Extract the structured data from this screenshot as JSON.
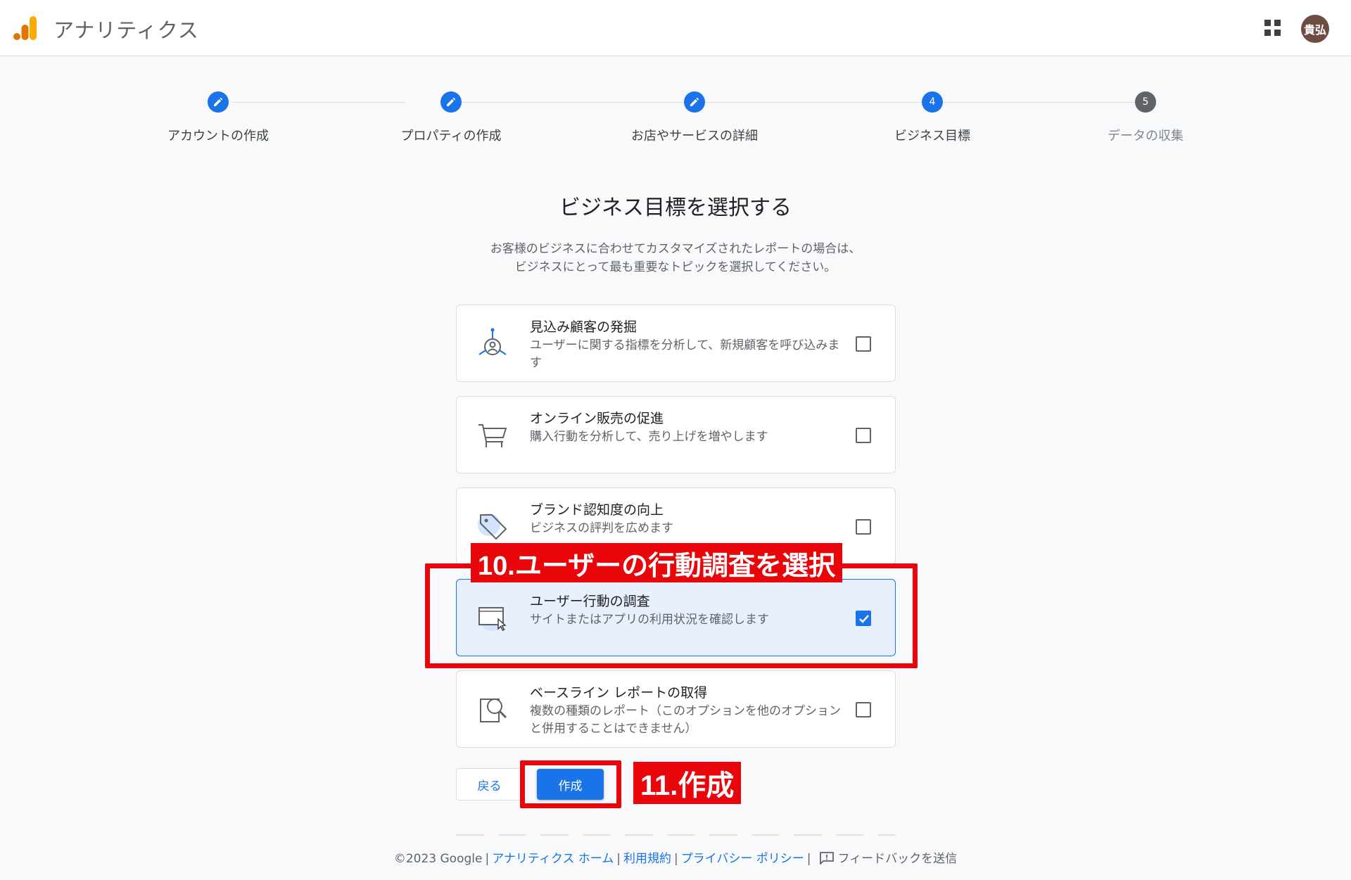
{
  "header": {
    "app_title": "アナリティクス",
    "logo_icon": "analytics-logo-icon",
    "apps_icon": "apps-grid-icon",
    "avatar_text": "貴弘",
    "avatar_color": "#6d4c41"
  },
  "stepper": {
    "steps": [
      {
        "label": "アカウントの作成",
        "state": "done",
        "icon": "edit-pencil-icon"
      },
      {
        "label": "プロパティの作成",
        "state": "done",
        "icon": "edit-pencil-icon"
      },
      {
        "label": "お店やサービスの詳細",
        "state": "done",
        "icon": "edit-pencil-icon"
      },
      {
        "label": "ビジネス目標",
        "state": "current",
        "number": "4"
      },
      {
        "label": "データの収集",
        "state": "upcoming",
        "number": "5"
      }
    ]
  },
  "main": {
    "headline": "ビジネス目標を選択する",
    "subtitle_line1": "お客様のビジネスに合わせてカスタマイズされたレポートの場合は、",
    "subtitle_line2": "ビジネスにとって最も重要なトピックを選択してください。",
    "goals": [
      {
        "title": "見込み顧客の発掘",
        "description": "ユーザーに関する指標を分析して、新規顧客を呼び込みます",
        "checked": false,
        "icon": "lead-generation-icon"
      },
      {
        "title": "オンライン販売の促進",
        "description": "購入行動を分析して、売り上げを増やします",
        "checked": false,
        "icon": "shopping-cart-icon"
      },
      {
        "title": "ブランド認知度の向上",
        "description": "ビジネスの評判を広めます",
        "checked": false,
        "icon": "tag-icon"
      },
      {
        "title": "ユーザー行動の調査",
        "description": "サイトまたはアプリの利用状況を確認します",
        "checked": true,
        "icon": "browser-cursor-icon"
      },
      {
        "title": "ベースライン レポートの取得",
        "description": "複数の種類のレポート（このオプションを他のオプションと併用することはできません）",
        "checked": false,
        "icon": "report-magnifier-icon"
      }
    ],
    "back_label": "戻る",
    "create_label": "作成"
  },
  "annotations": {
    "step10": "10.ユーザーの行動調査を選択",
    "step11": "11.作成",
    "color": "#e8060b"
  },
  "footer": {
    "copyright": "©2023 Google",
    "links": [
      "アナリティクス ホーム",
      "利用規約",
      "プライバシー ポリシー"
    ],
    "feedback": "フィードバックを送信"
  },
  "colors": {
    "primary": "#1a73e8",
    "background": "#f8f9fa"
  }
}
